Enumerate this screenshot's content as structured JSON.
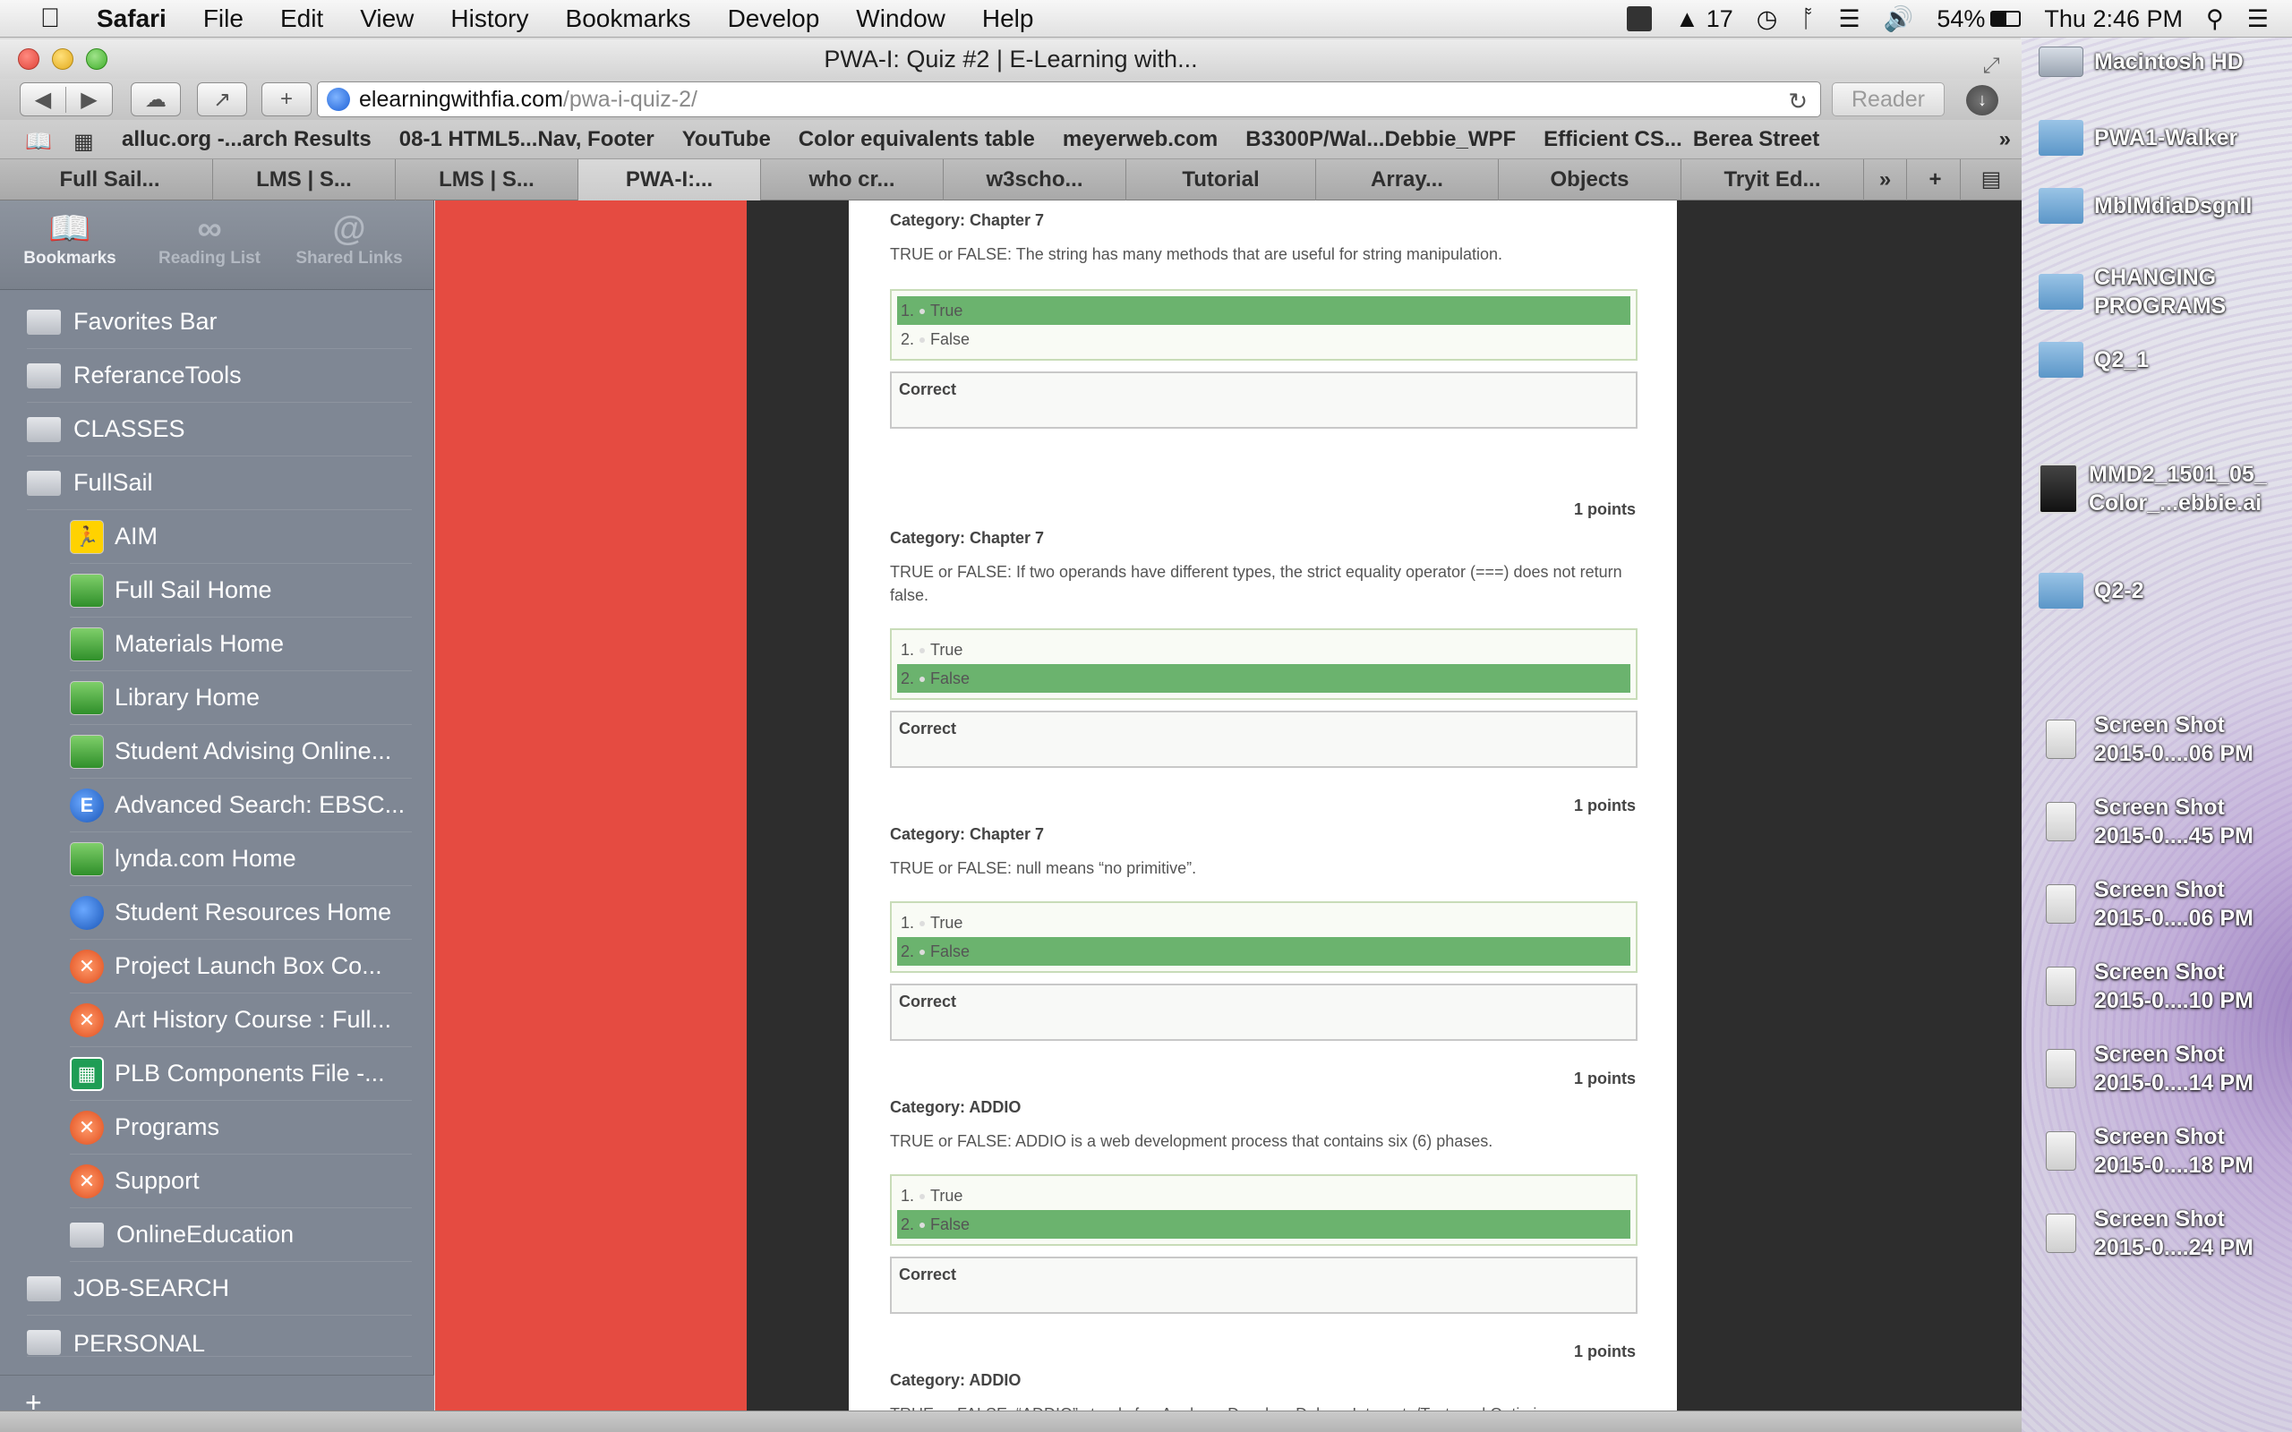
{
  "menubar": {
    "app": "Safari",
    "items": [
      "File",
      "Edit",
      "View",
      "History",
      "Bookmarks",
      "Develop",
      "Window",
      "Help"
    ],
    "status": {
      "adobe_count": "17",
      "battery": "54%",
      "clock": "Thu 2:46 PM"
    }
  },
  "window": {
    "title": "PWA-I: Quiz #2 | E-Learning with...",
    "url_domain": "elearningwithfia.com",
    "url_path": "/pwa-i-quiz-2/",
    "reader_label": "Reader"
  },
  "bookmarks_bar": [
    "alluc.org -...arch Results",
    "08-1 HTML5...Nav, Footer",
    "YouTube",
    "Color equivalents table",
    "meyerweb.com",
    "B3300P/Wal...Debbie_WPF",
    "Efficient CS...",
    "Berea Street"
  ],
  "tabs": [
    "Full Sail...",
    "LMS | S...",
    "LMS | S...",
    "PWA-I:...",
    "who cr...",
    "w3scho...",
    "Tutorial",
    "Array...",
    "Objects",
    "Tryit Ed..."
  ],
  "sidebar": {
    "header_tabs": [
      {
        "label": "Bookmarks",
        "icon": "book-icon"
      },
      {
        "label": "Reading List",
        "icon": "glasses-icon"
      },
      {
        "label": "Shared Links",
        "icon": "at-icon"
      }
    ],
    "items": [
      {
        "label": "Favorites Bar",
        "type": "folder"
      },
      {
        "label": "ReferanceTools",
        "type": "folder"
      },
      {
        "label": "CLASSES",
        "type": "folder"
      },
      {
        "label": "FullSail",
        "type": "folder"
      },
      {
        "label": "AIM",
        "type": "aim"
      },
      {
        "label": "Full Sail Home",
        "type": "fs"
      },
      {
        "label": "Materials Home",
        "type": "fs"
      },
      {
        "label": "Library Home",
        "type": "fs"
      },
      {
        "label": "Student Advising Online...",
        "type": "fs"
      },
      {
        "label": "Advanced Search: EBSC...",
        "type": "ebsco"
      },
      {
        "label": "lynda.com Home",
        "type": "fs"
      },
      {
        "label": "Student Resources Home",
        "type": "globe"
      },
      {
        "label": "Project Launch Box Co...",
        "type": "plb"
      },
      {
        "label": "Art History Course : Full...",
        "type": "plb"
      },
      {
        "label": "PLB Components File -...",
        "type": "sheet"
      },
      {
        "label": "Programs",
        "type": "plb"
      },
      {
        "label": "Support",
        "type": "plb"
      },
      {
        "label": "OnlineEducation",
        "type": "folder"
      },
      {
        "label": "JOB-SEARCH",
        "type": "folder"
      },
      {
        "label": "PERSONAL",
        "type": "folder"
      }
    ]
  },
  "quiz": {
    "questions": [
      {
        "category": "Category: Chapter 7",
        "text": "TRUE or FALSE:  The string has many methods that are useful for string manipulation.",
        "answers": [
          "True",
          "False"
        ],
        "selected": 0,
        "result": "Correct",
        "points": null
      },
      {
        "category": "Category: Chapter 7",
        "text": "TRUE or FALSE:  If two operands have different types, the strict equality operator (===) does not return false.",
        "answers": [
          "True",
          "False"
        ],
        "selected": 1,
        "result": "Correct",
        "points": "1 points"
      },
      {
        "category": "Category: Chapter 7",
        "text": "TRUE or FALSE: null means “no primitive”.",
        "answers": [
          "True",
          "False"
        ],
        "selected": 1,
        "result": "Correct",
        "points": "1 points"
      },
      {
        "category": "Category: ADDIO",
        "text": "TRUE or FALSE:  ADDIO is a web development process that contains six (6) phases.",
        "answers": [
          "True",
          "False"
        ],
        "selected": 1,
        "result": "Correct",
        "points": "1 points"
      },
      {
        "category": "Category: ADDIO",
        "text": "TRUE or FALSE:  “ADDIO” stands for:  Analyze, Develop, Debug, Integrate/Test, and Optimize",
        "answers": [],
        "selected": null,
        "result": null,
        "points": "1 points"
      }
    ],
    "colors": {
      "selected": "#6bb36e",
      "red_column": "#e54b41"
    }
  },
  "desktop": {
    "items": [
      {
        "label": "Macintosh HD",
        "type": "drive"
      },
      {
        "label": "PWA1-Walker",
        "type": "folder"
      },
      {
        "label": "MblMdiaDsgnII",
        "type": "folder"
      },
      {
        "label": "CHANGING\nPROGRAMS",
        "type": "folder"
      },
      {
        "label": "Q2_1",
        "type": "folder"
      },
      {
        "label": "MMD2_1501_05_\nColor_...ebbie.ai",
        "type": "doc"
      },
      {
        "label": "Q2-2",
        "type": "folder"
      },
      {
        "label": "Screen Shot\n2015-0....06 PM",
        "type": "shot"
      },
      {
        "label": "Screen Shot\n2015-0....45 PM",
        "type": "shot"
      },
      {
        "label": "Screen Shot\n2015-0....06 PM",
        "type": "shot"
      },
      {
        "label": "Screen Shot\n2015-0....10 PM",
        "type": "shot"
      },
      {
        "label": "Screen Shot\n2015-0....14 PM",
        "type": "shot"
      },
      {
        "label": "Screen Shot\n2015-0....18 PM",
        "type": "shot"
      },
      {
        "label": "Screen Shot\n2015-0....24 PM",
        "type": "shot"
      }
    ]
  }
}
